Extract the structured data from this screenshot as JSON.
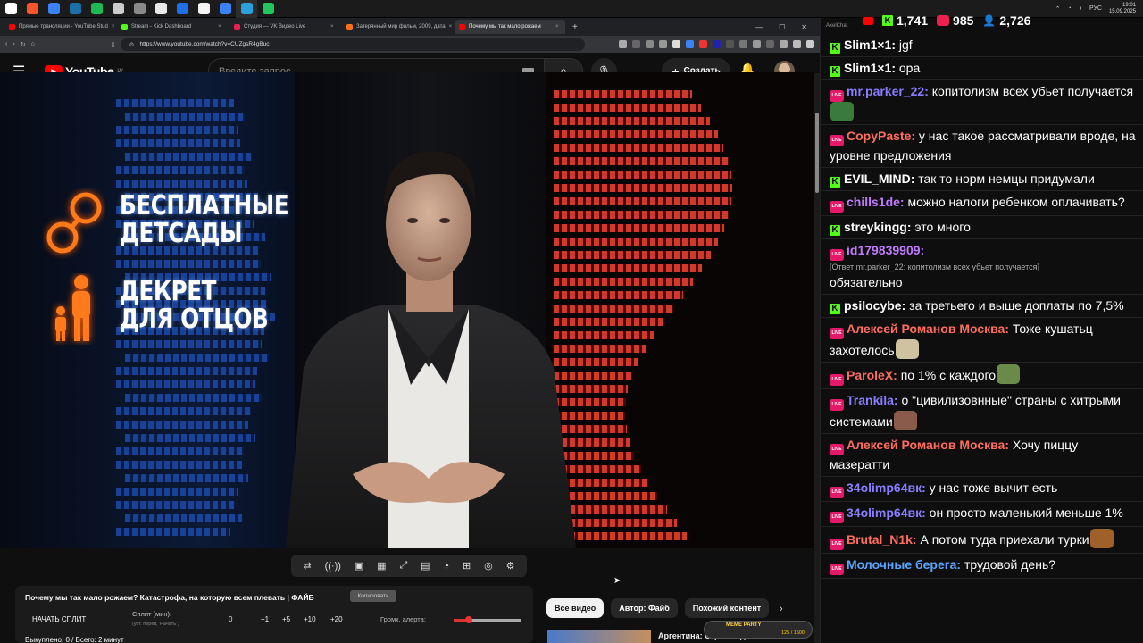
{
  "taskbar": {
    "icons": [
      {
        "name": "windows-start-icon",
        "color": "#ffffff"
      },
      {
        "name": "brave-browser-icon",
        "color": "#fb542b"
      },
      {
        "name": "messenger-icon",
        "color": "#3b82f6"
      },
      {
        "name": "steam-icon",
        "color": "#1b6fa8"
      },
      {
        "name": "spotify-icon",
        "color": "#1db954"
      },
      {
        "name": "obs-icon",
        "color": "#cccccc"
      },
      {
        "name": "app-icon",
        "color": "#8a8a8a"
      },
      {
        "name": "app-icon",
        "color": "#e8e8e8"
      },
      {
        "name": "app-icon",
        "color": "#1f6feb"
      },
      {
        "name": "app-icon",
        "color": "#f5f5f5"
      },
      {
        "name": "app-icon",
        "color": "#3b82f6"
      },
      {
        "name": "telegram-icon",
        "color": "#2aa1da"
      },
      {
        "name": "app-icon",
        "color": "#22c55e"
      }
    ],
    "lang": "РУС",
    "time": "19:01",
    "date": "15.09.2025"
  },
  "browser": {
    "tabs": [
      {
        "title": "Прямые трансляции - YouTube Stud",
        "color": "#ff0000",
        "active": false
      },
      {
        "title": "Stream - Kick Dashboard",
        "color": "#53fc18",
        "active": false
      },
      {
        "title": "Студия — VK Видео Live",
        "color": "#ec1f4f",
        "active": false
      },
      {
        "title": "Затерянный мир фильм, 2009, дата",
        "color": "#f97316",
        "active": false
      },
      {
        "title": "Почему мы так мало рожаем",
        "color": "#ff0000",
        "active": true
      }
    ],
    "url": "https://www.youtube.com/watch?v=CUZgsR4gBuc"
  },
  "youtube": {
    "logo": "YouTube",
    "region": "LV",
    "search_placeholder": "Введите запрос",
    "create_label": "Создать"
  },
  "video": {
    "overlay_line1": "БЕСПЛАТНЫЕ\nДЕТСАДЫ",
    "overlay_line2": "ДЕКРЕТ\nДЛЯ ОТЦОВ"
  },
  "panel": {
    "title": "Почему мы так мало рожаем? Катастрофа, на которую всем плевать | ФАЙБ",
    "copy_label": "Копировать",
    "split_button": "НАЧАТЬ СПЛИТ",
    "split_label": "Сплит (мин):",
    "split_hint": "(уст. перед \"Начать\")",
    "split_value": "0",
    "increments": [
      "+1",
      "+5",
      "+10",
      "+20"
    ],
    "volume_label": "Громк. алерта:",
    "volume_level": 0.04,
    "status": "Выкуплено: 0 / Всего: 2 минут"
  },
  "chips": {
    "items": [
      "Все видео",
      "Автор: Файб",
      "Похожий контент"
    ],
    "next_video_title": "Аргентина: Страна идиотских"
  },
  "meme_party": {
    "label": "MEME PARTY",
    "progress": "125 / 1500"
  },
  "chat": {
    "app_name": "AxelChat",
    "stats": {
      "kick": "1,741",
      "vk": "985",
      "viewers": "2,726"
    },
    "messages": [
      {
        "platform": "kick",
        "user": "Slim1×1",
        "color": "#ffffff",
        "text": "jgf"
      },
      {
        "platform": "kick",
        "user": "Slim1×1",
        "color": "#ffffff",
        "text": "ора"
      },
      {
        "platform": "vk",
        "user": "mr.parker_22",
        "color": "#8a7dff",
        "text": "копитолизм всех убьет получается",
        "emote": "#3a7a3a"
      },
      {
        "platform": "vk",
        "user": "CopyPaste",
        "color": "#ff6d5e",
        "text": "у нас такое рассматривали вроде, на уровне предложения"
      },
      {
        "platform": "kick",
        "user": "EVIL_MIND",
        "color": "#ffffff",
        "text": "так то норм немцы придумали"
      },
      {
        "platform": "vk",
        "user": "chills1de",
        "color": "#c07bff",
        "text": "можно налоги ребенком оплачивать?"
      },
      {
        "platform": "kick",
        "user": "streykingg",
        "color": "#ffffff",
        "text": "это много"
      },
      {
        "platform": "vk",
        "user": "id179839909",
        "color": "#c07bff",
        "reply": "[Ответ mr.parker_22: копитолизм всех убьет получается]",
        "text": "обязательно"
      },
      {
        "platform": "kick",
        "user": "psilocybe",
        "color": "#ffffff",
        "text": "за третьего и выше доплаты по 7,5%"
      },
      {
        "platform": "vk",
        "user": "Алексей Романов Москва",
        "color": "#ff6d5e",
        "text": "Тоже кушатьц захотелось",
        "emote": "#cfc2a0"
      },
      {
        "platform": "vk",
        "user": "ParoleX",
        "color": "#ff6d5e",
        "text": "по 1% с каждого",
        "emote": "#6a8a4a"
      },
      {
        "platform": "vk",
        "user": "Trankila",
        "color": "#8a7dff",
        "text": "о \"цивилизовнные\" страны с хитрыми системами",
        "emote": "#8a5a4a"
      },
      {
        "platform": "vk",
        "user": "Алексей Романов Москва",
        "color": "#ff6d5e",
        "text": "Хочу пиццу мазератти"
      },
      {
        "platform": "vk",
        "user": "34olimp64вк",
        "color": "#8a7dff",
        "text": "у нас тоже вычит есть"
      },
      {
        "platform": "vk",
        "user": "34olimp64вк",
        "color": "#8a7dff",
        "text": "он просто маленький меньше 1%"
      },
      {
        "platform": "vk",
        "user": "Brutal_N1k",
        "color": "#ff6d5e",
        "text": "А потом туда приехали турки",
        "emote": "#a0602a",
        "emote_block": true
      },
      {
        "platform": "vk",
        "user": "Молочные берега",
        "color": "#5aa6ff",
        "text": "трудовой день?"
      }
    ]
  }
}
